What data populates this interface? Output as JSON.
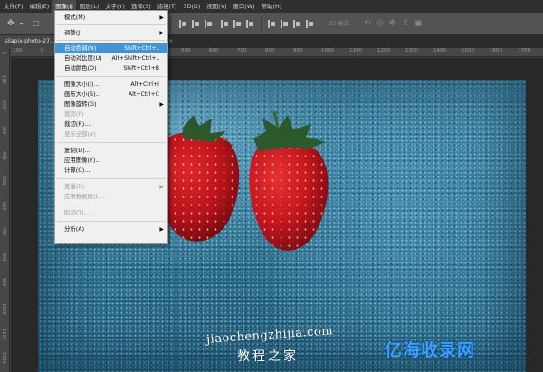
{
  "menubar": {
    "items": [
      "文件(F)",
      "编辑(E)",
      "图像(I)",
      "图层(L)",
      "文字(Y)",
      "选择(S)",
      "滤镜(T)",
      "3D(D)",
      "视图(V)",
      "窗口(W)",
      "帮助(H)"
    ],
    "active_index": 2
  },
  "optbar": {
    "mode3d": "3D 模式:"
  },
  "tabs": {
    "doc1": "silapix-photo-27...",
    "doc2_close": "×"
  },
  "ruler": {
    "h_ticks": [
      "100",
      "0",
      "100",
      "200",
      "300",
      "400",
      "500",
      "600",
      "700",
      "800",
      "900",
      "1000",
      "1100",
      "1200",
      "1300",
      "1400",
      "1500",
      "1600",
      "1700"
    ],
    "v_ticks": [
      "0",
      "100",
      "200",
      "300",
      "400",
      "500",
      "600",
      "700",
      "800",
      "900",
      "1000",
      "1100",
      "1200"
    ]
  },
  "menu": {
    "rows": [
      {
        "label": "模式(M)",
        "shortcut": "",
        "submenu": true,
        "disabled": false
      },
      {
        "label": "调整(J)",
        "shortcut": "",
        "submenu": true,
        "disabled": false
      },
      {
        "label": "自动色调(N)",
        "shortcut": "Shift+Ctrl+L",
        "submenu": false,
        "disabled": false,
        "highlighted": true
      },
      {
        "label": "自动对比度(U)",
        "shortcut": "Alt+Shift+Ctrl+L",
        "submenu": false,
        "disabled": false
      },
      {
        "label": "自动颜色(O)",
        "shortcut": "Shift+Ctrl+B",
        "submenu": false,
        "disabled": false
      },
      {
        "label": "图像大小(I)...",
        "shortcut": "Alt+Ctrl+I",
        "submenu": false,
        "disabled": false
      },
      {
        "label": "画布大小(S)...",
        "shortcut": "Alt+Ctrl+C",
        "submenu": false,
        "disabled": false
      },
      {
        "label": "图像旋转(G)",
        "shortcut": "",
        "submenu": true,
        "disabled": false
      },
      {
        "label": "裁剪(P)",
        "shortcut": "",
        "submenu": false,
        "disabled": true
      },
      {
        "label": "裁切(R)...",
        "shortcut": "",
        "submenu": false,
        "disabled": false
      },
      {
        "label": "显示全部(V)",
        "shortcut": "",
        "submenu": false,
        "disabled": true
      },
      {
        "label": "复制(D)...",
        "shortcut": "",
        "submenu": false,
        "disabled": false
      },
      {
        "label": "应用图像(Y)...",
        "shortcut": "",
        "submenu": false,
        "disabled": false
      },
      {
        "label": "计算(C)...",
        "shortcut": "",
        "submenu": false,
        "disabled": false
      },
      {
        "label": "变量(B)",
        "shortcut": "",
        "submenu": true,
        "disabled": true
      },
      {
        "label": "应用数据组(L)...",
        "shortcut": "",
        "submenu": false,
        "disabled": true
      },
      {
        "label": "陷印(T)...",
        "shortcut": "",
        "submenu": false,
        "disabled": true
      },
      {
        "label": "分析(A)",
        "shortcut": "",
        "submenu": true,
        "disabled": false
      }
    ]
  },
  "watermark": {
    "site_pinyin": "jiaochengzhijia.com",
    "site_cn": "教程之家",
    "logo_text": "亿海收录网"
  },
  "colors": {
    "accent_highlight": "#3f95d8",
    "logo_blue": "#3aa0ff",
    "menu_bg": "#f0f0f0"
  }
}
